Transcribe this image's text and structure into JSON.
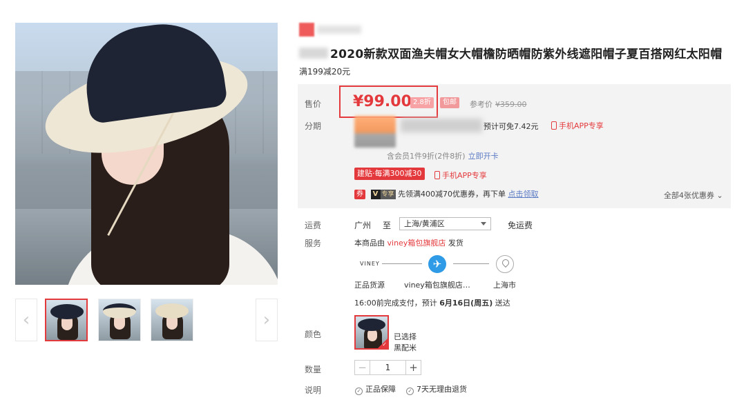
{
  "title": "2020新款双面渔夫帽女大帽檐防晒帽防紫外线遮阳帽子夏百搭网红太阳帽",
  "promo": "满199减20元",
  "labels": {
    "price": "售价",
    "installment": "分期",
    "shipping": "运费",
    "service": "服务",
    "color": "颜色",
    "quantity": "数量",
    "notes": "说明"
  },
  "price": {
    "current": "¥99.00",
    "discount": "2.8折",
    "free_shipping": "包邮",
    "reference_label": "参考价",
    "reference": "¥359.00"
  },
  "installment": {
    "fee_text": "预计可免7.42元",
    "app_only": "手机APP专享",
    "member_text": "含会员1件9折(2件8折)",
    "member_link": "立即开卡"
  },
  "promotion": {
    "tag": "建贴·每满300减30",
    "app_only": "手机APP专享"
  },
  "coupon": {
    "quan": "券",
    "vip": "V",
    "vip_label": "专享",
    "text": "先领满400减70优惠券，再下单",
    "link": "点击领取",
    "all": "全部4张优惠券"
  },
  "shipping": {
    "from": "广州",
    "to_word": "至",
    "destination": "上海/黄浦区",
    "fee": "免运费"
  },
  "service": {
    "prefix": "本商品由",
    "shop": "viney箱包旗舰店",
    "suffix": "发货"
  },
  "route": {
    "brand": "VINEY",
    "origin": "正品货源",
    "middle": "viney箱包旗舰店…",
    "destination": "上海市",
    "delivery_prefix": "16:00前完成支付，预计",
    "delivery_date": "6月16日(周五)",
    "delivery_suffix": "送达"
  },
  "color": {
    "selected_label": "已选择",
    "selected_value": "黑配米"
  },
  "quantity": {
    "minus": "−",
    "value": "1",
    "plus": "+"
  },
  "guarantees": [
    "正品保障",
    "7天无理由退货"
  ],
  "gallery": {
    "prev": "‹",
    "next": "›"
  },
  "colors": {
    "accent": "#e4393c",
    "link": "#5a7ac4",
    "panel": "#f3f3f3"
  }
}
